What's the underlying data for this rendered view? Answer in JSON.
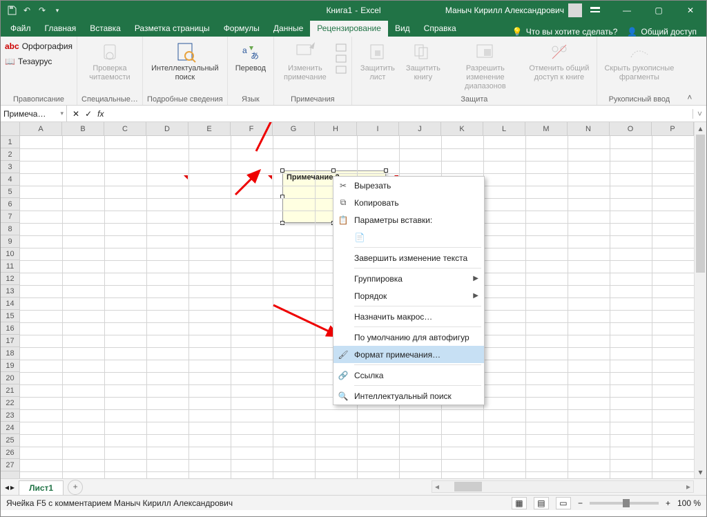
{
  "title": {
    "book": "Книга1",
    "dash": "  -  ",
    "app": "Excel"
  },
  "user": "Маныч Кирилл Александрович",
  "tabs": [
    "Файл",
    "Главная",
    "Вставка",
    "Разметка страницы",
    "Формулы",
    "Данные",
    "Рецензирование",
    "Вид",
    "Справка"
  ],
  "tellme": "Что вы хотите сделать?",
  "share": "Общий доступ",
  "ribbon": {
    "proofing": {
      "spell": "Орфография",
      "thes": "Тезаурус",
      "label": "Правописание"
    },
    "access": {
      "btn": "Проверка\nчитаемости",
      "label": "Специальные…"
    },
    "insights": {
      "btn": "Интеллектуальный\nпоиск",
      "label": "Подробные сведения"
    },
    "lang": {
      "btn": "Перевод",
      "label": "Язык"
    },
    "comments": {
      "btn": "Изменить\nпримечание",
      "label": "Примечания"
    },
    "protect": {
      "sheet": "Защитить\nлист",
      "book": "Защитить\nкнигу",
      "ranges": "Разрешить изменение\nдиапазонов",
      "unshare": "Отменить общий\nдоступ к книге",
      "label": "Защита"
    },
    "ink": {
      "btn": "Скрыть рукописные\nфрагменты",
      "label": "Рукописный ввод"
    }
  },
  "namebox": "Примеча…",
  "cols": [
    "A",
    "B",
    "C",
    "D",
    "E",
    "F",
    "G",
    "H",
    "I",
    "J",
    "K",
    "L",
    "M",
    "N",
    "O",
    "P"
  ],
  "comment_text": "Примечание 2",
  "menu": {
    "cut": "Вырезать",
    "copy": "Копировать",
    "paste_hdr": "Параметры вставки:",
    "endedit": "Завершить изменение текста",
    "group": "Группировка",
    "order": "Порядок",
    "macro": "Назначить макрос…",
    "default": "По умолчанию для автофигур",
    "format": "Формат примечания…",
    "link": "Ссылка",
    "smart": "Интеллектуальный поиск"
  },
  "sheet": "Лист1",
  "status": "Ячейка F5 с комментарием Маныч Кирилл Александрович",
  "zoom": "100 %"
}
